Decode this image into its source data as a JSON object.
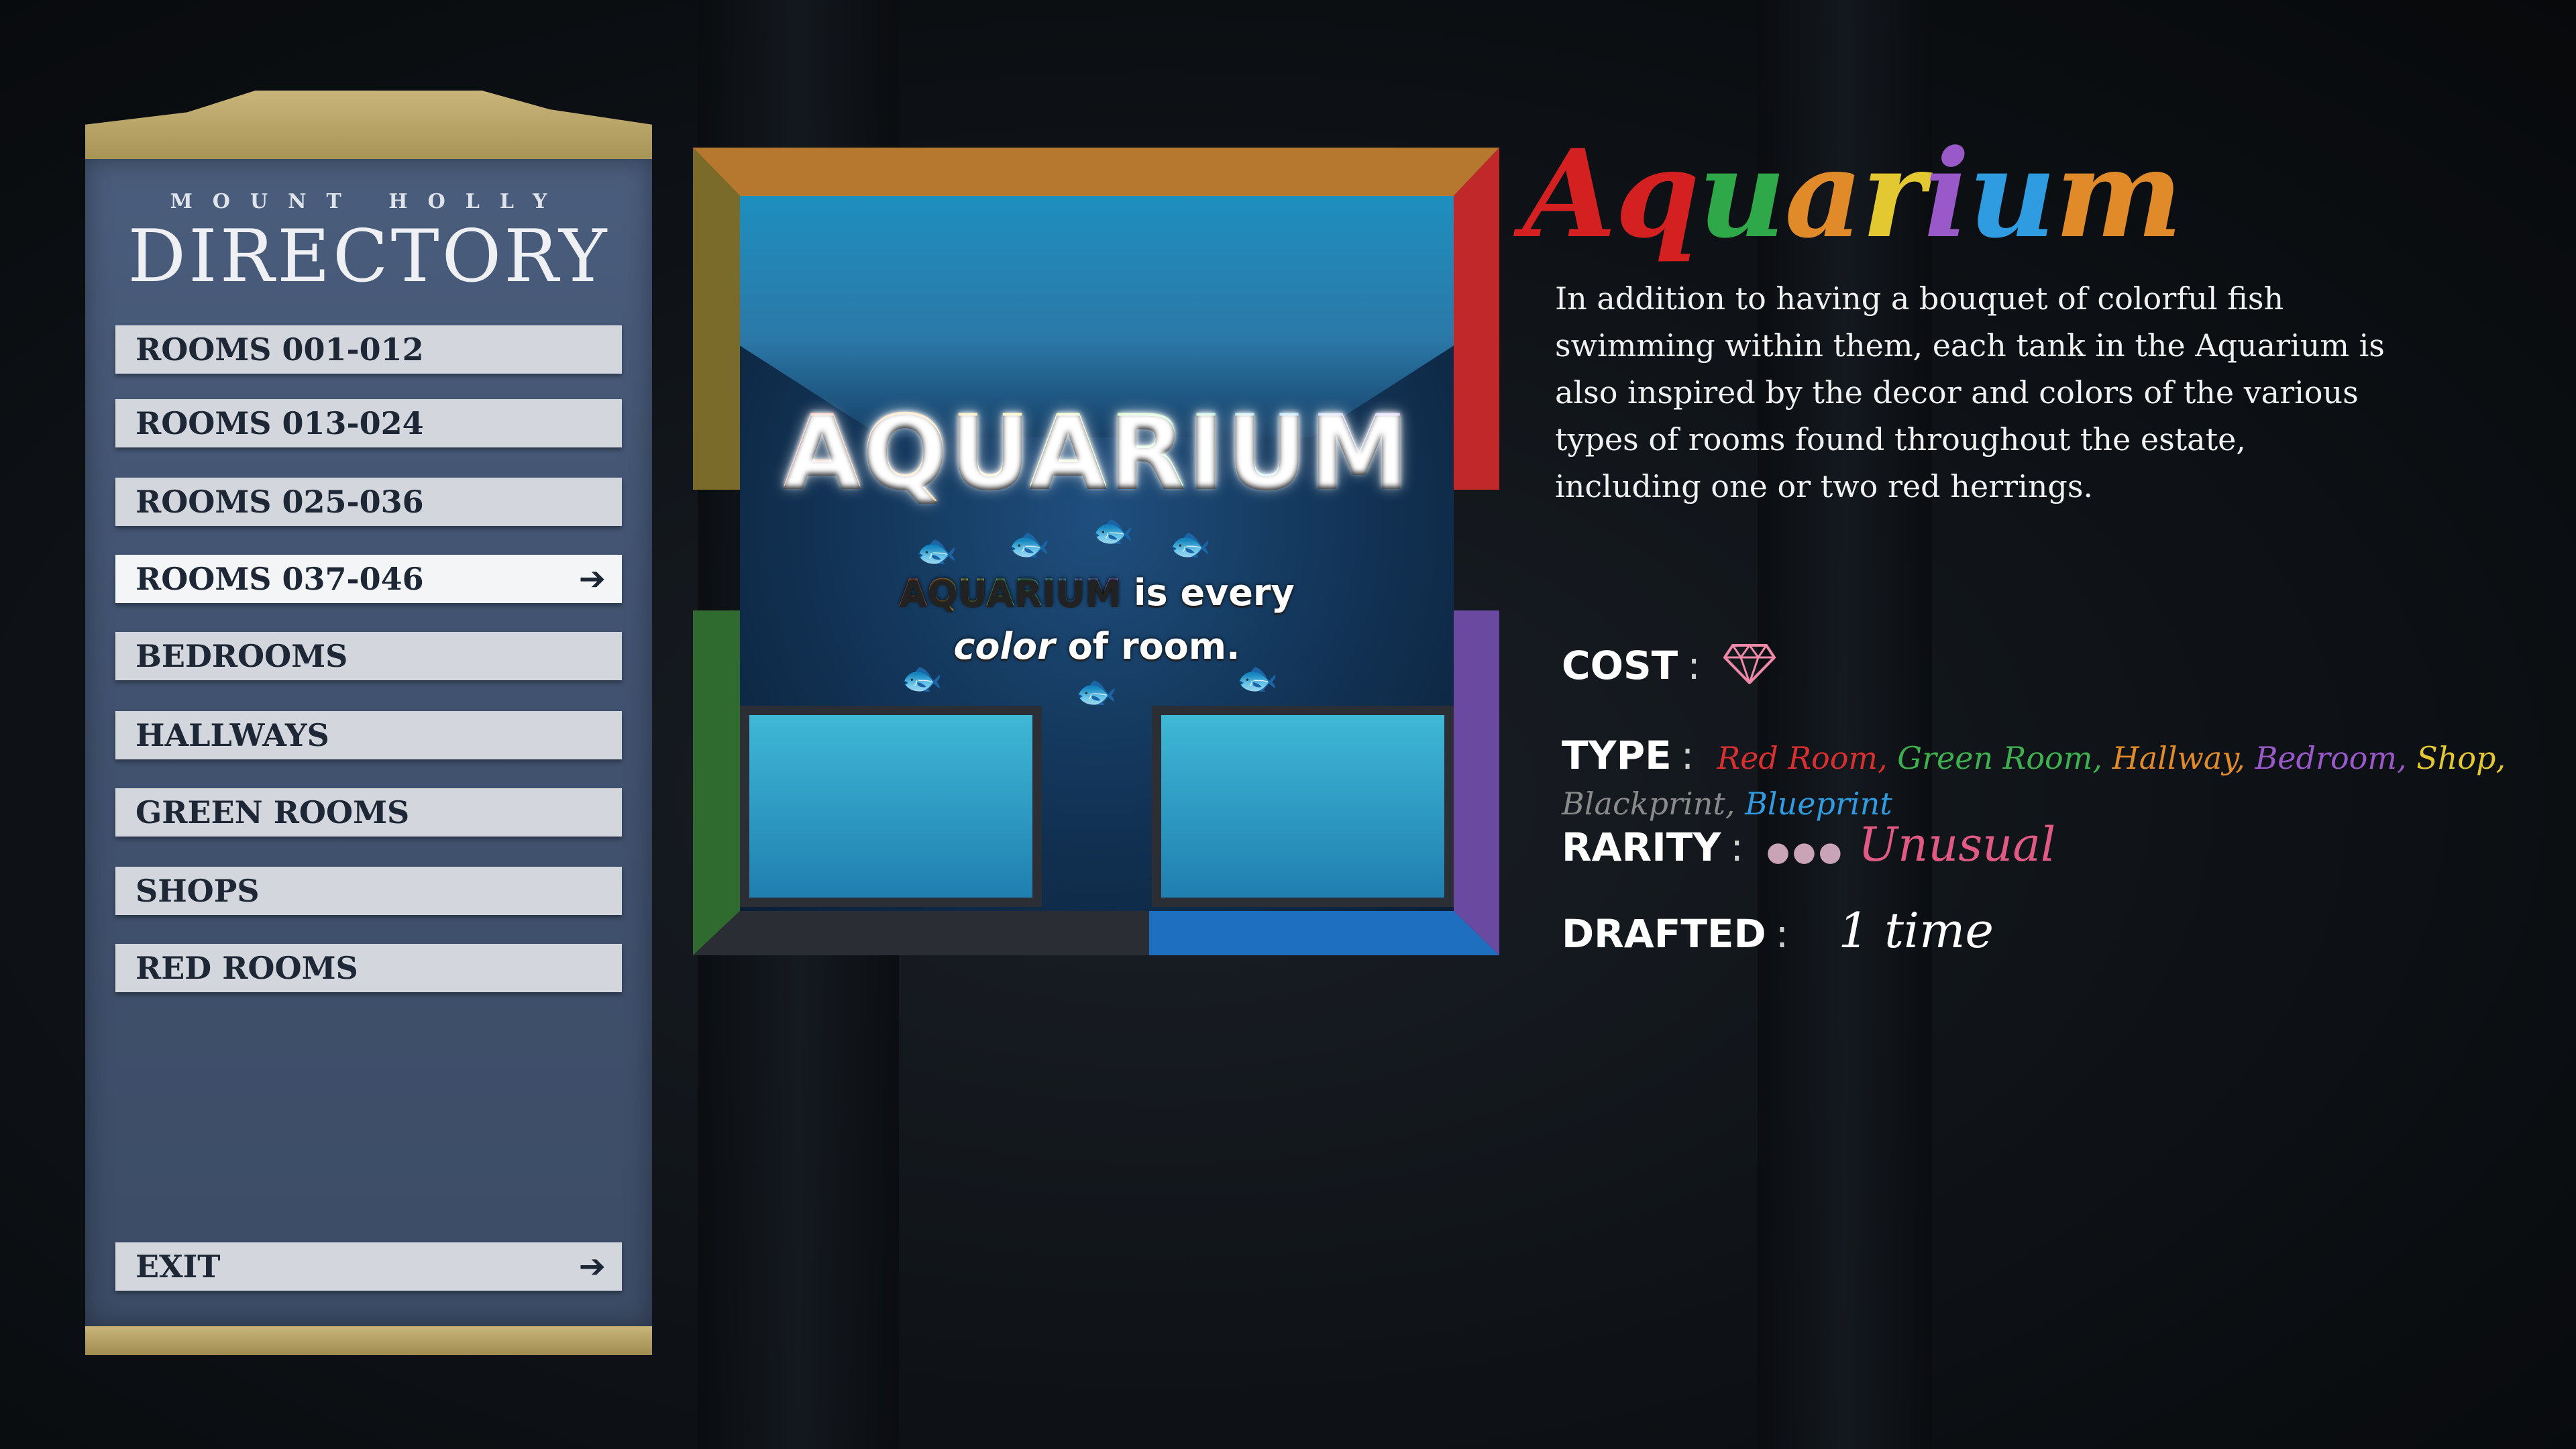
{
  "directory": {
    "subtitle": "MOUNT HOLLY",
    "title": "DIRECTORY",
    "items": [
      {
        "label": "ROOMS 001-012",
        "selected": false
      },
      {
        "label": "ROOMS 013-024",
        "selected": false
      },
      {
        "label": "ROOMS 025-036",
        "selected": false
      },
      {
        "label": "ROOMS 037-046",
        "selected": true
      },
      {
        "label": "BEDROOMS",
        "selected": false
      },
      {
        "label": "HALLWAYS",
        "selected": false
      },
      {
        "label": "GREEN ROOMS",
        "selected": false
      },
      {
        "label": "SHOPS",
        "selected": false
      },
      {
        "label": "RED ROOMS",
        "selected": false
      }
    ],
    "exit_label": "EXIT",
    "arrow_glyph": "➔"
  },
  "room_card": {
    "art_title": "AQUARIUM",
    "art_line1_highlight": "AQUARIUM",
    "art_line1_rest": " is every",
    "art_line2_a": "color",
    "art_line2_b": " of room."
  },
  "room": {
    "name": "Aquarium",
    "name_letter_colors": [
      "#d42020",
      "#d42020",
      "#2fa84a",
      "#e08a2a",
      "#e3c832",
      "#9a59c8",
      "#2f9be0",
      "#e08a2a"
    ],
    "description": "In addition to having a bouquet of colorful fish swimming within them, each tank in the Aquarium is also inspired by the decor and colors of the various types of rooms found throughout the estate, including one or two red herrings."
  },
  "stats": {
    "cost_label": "COST",
    "cost_icon": "gem-icon",
    "type_label": "TYPE",
    "types": [
      {
        "name": "Red Room",
        "color": "#d83030"
      },
      {
        "name": "Green Room",
        "color": "#3fb04f"
      },
      {
        "name": "Hallway",
        "color": "#e08a2a"
      },
      {
        "name": "Bedroom",
        "color": "#9a59c8"
      },
      {
        "name": "Shop",
        "color": "#e3c832"
      },
      {
        "name": "Blackprint",
        "color": "#8a8a8a"
      },
      {
        "name": "Blueprint",
        "color": "#2f9be0"
      }
    ],
    "rarity_label": "RARITY",
    "rarity_value": "Unusual",
    "drafted_label": "DRAFTED",
    "drafted_value": "1 time"
  },
  "colors": {
    "board": "#415370",
    "gold_trim": "#c9b57a",
    "frame_orange": "#b5782e",
    "frame_red": "#c0282a",
    "frame_green": "#2f6a2e",
    "frame_purple": "#6a4aa0",
    "frame_blue": "#1f6fc0",
    "frame_olive": "#7a6b2a"
  }
}
